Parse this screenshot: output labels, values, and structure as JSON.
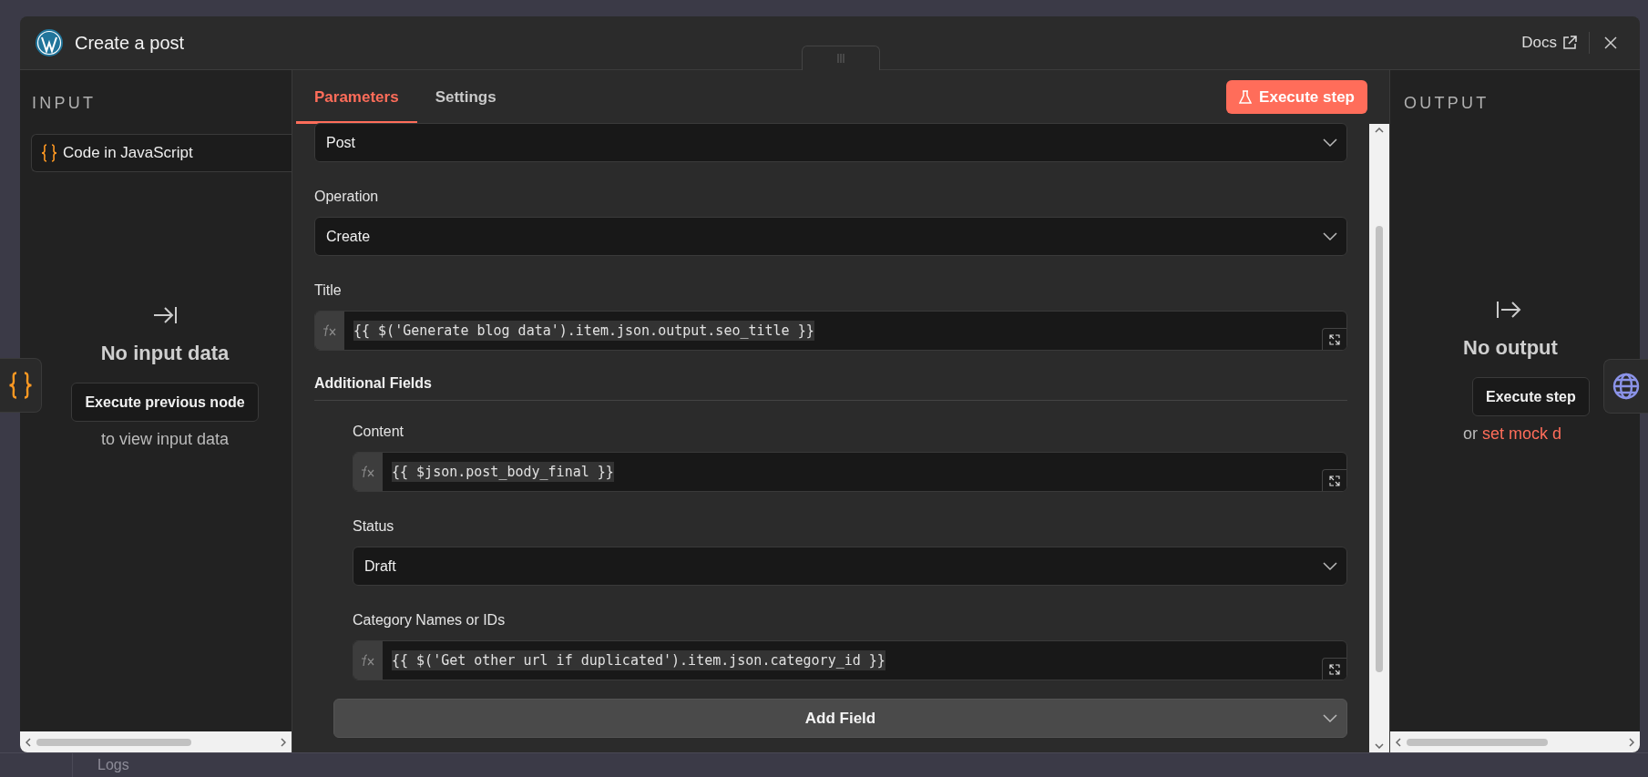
{
  "canvas": {
    "logs_label": "Logs"
  },
  "modal": {
    "title": "Create a post",
    "docs_link": "Docs"
  },
  "input_panel": {
    "heading": "INPUT",
    "source_node": "Code in JavaScript",
    "empty_title": "No input data",
    "action_button": "Execute previous node",
    "action_hint": "to view input data"
  },
  "tabs": [
    {
      "label": "Parameters",
      "selected": true
    },
    {
      "label": "Settings",
      "selected": false
    }
  ],
  "execute_button": "Execute step",
  "parameters": [
    {
      "kind": "select",
      "value": "Post"
    },
    {
      "kind": "select",
      "label": "Operation",
      "value": "Create"
    },
    {
      "kind": "expression",
      "label": "Title",
      "value": "{{ $('Generate blog data').item.json.output.seo_title }}"
    },
    {
      "kind": "section",
      "label": "Additional Fields"
    }
  ],
  "additional_fields": [
    {
      "kind": "expression",
      "label": "Content",
      "value": "{{ $json.post_body_final }}"
    },
    {
      "kind": "select",
      "label": "Status",
      "value": "Draft"
    },
    {
      "kind": "expression",
      "label": "Category Names or IDs",
      "value": "{{ $('Get other url if duplicated').item.json.category_id }}"
    }
  ],
  "add_field_button": "Add Field",
  "output_panel": {
    "heading": "OUTPUT",
    "empty_title": "No output",
    "action_button": "Execute step",
    "hint_prefix": "or",
    "hint_link": "set mock d"
  }
}
